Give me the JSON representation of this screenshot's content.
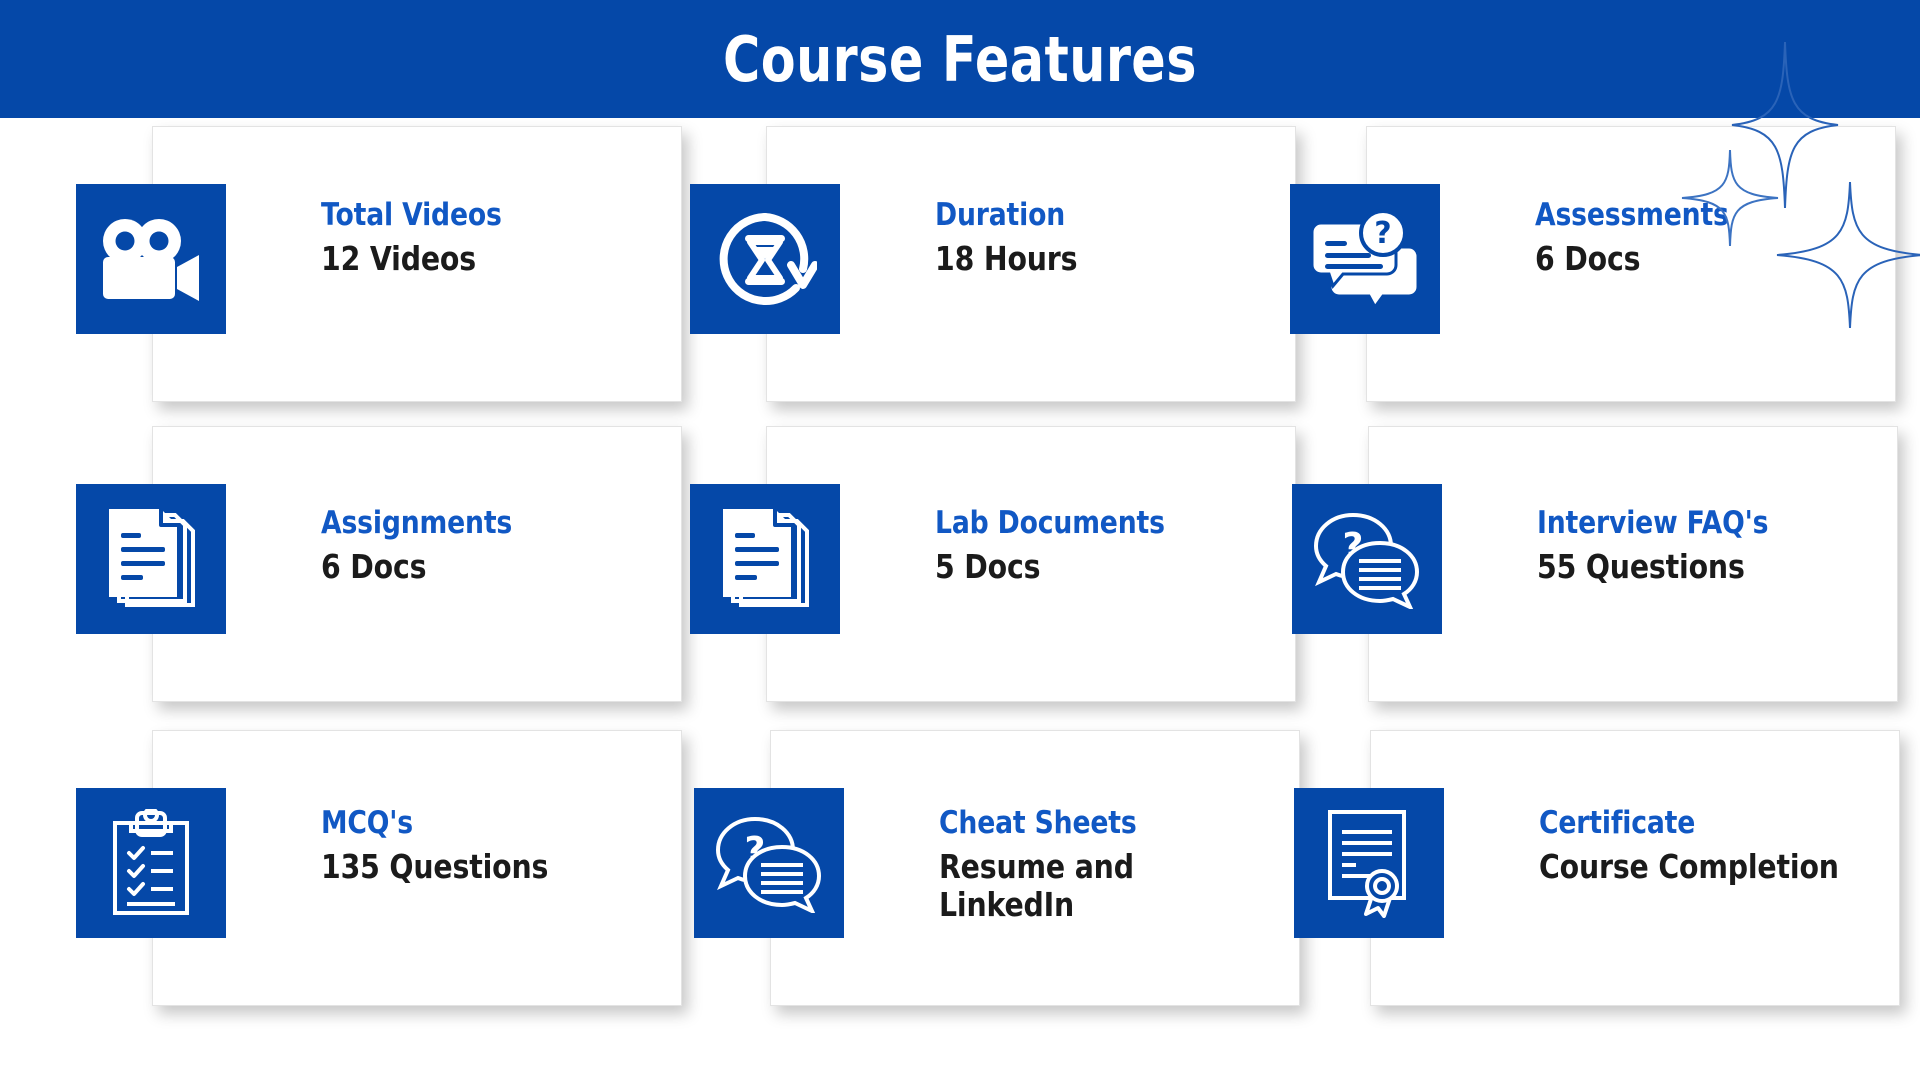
{
  "header": {
    "title": "Course Features",
    "background_color": "#0548A8",
    "text_color": "#ffffff"
  },
  "theme": {
    "brand_blue": "#0548A8",
    "title_blue": "#1158C4",
    "value_black": "#1b1b1b",
    "card_background": "#ffffff",
    "page_background": "#ffffff"
  },
  "decorations": {
    "sparkles": [
      {
        "name": "sparkle-large-top",
        "color": "#2a63b8"
      },
      {
        "name": "sparkle-small-left",
        "color": "#3c73c2"
      },
      {
        "name": "sparkle-large-bottom",
        "color": "#2a63b8"
      }
    ]
  },
  "cards": [
    {
      "icon": "video-camera-icon",
      "title": "Total Videos",
      "value": "12 Videos"
    },
    {
      "icon": "hourglass-duration-icon",
      "title": "Duration",
      "value": "18 Hours"
    },
    {
      "icon": "chat-question-assessment-icon",
      "title": "Assessments",
      "value": "6 Docs"
    },
    {
      "icon": "document-stack-icon",
      "title": "Assignments",
      "value": "6 Docs"
    },
    {
      "icon": "document-stack-icon",
      "title": "Lab Documents",
      "value": "5 Docs"
    },
    {
      "icon": "chat-bubbles-faq-icon",
      "title": "Interview FAQ's",
      "value": "55 Questions"
    },
    {
      "icon": "clipboard-checklist-icon",
      "title": "MCQ's",
      "value": "135 Questions"
    },
    {
      "icon": "chat-bubbles-faq-icon",
      "title": "Cheat Sheets",
      "value": "Resume and\nLinkedIn"
    },
    {
      "icon": "certificate-ribbon-icon",
      "title": "Certificate",
      "value": "Course Completion"
    }
  ]
}
